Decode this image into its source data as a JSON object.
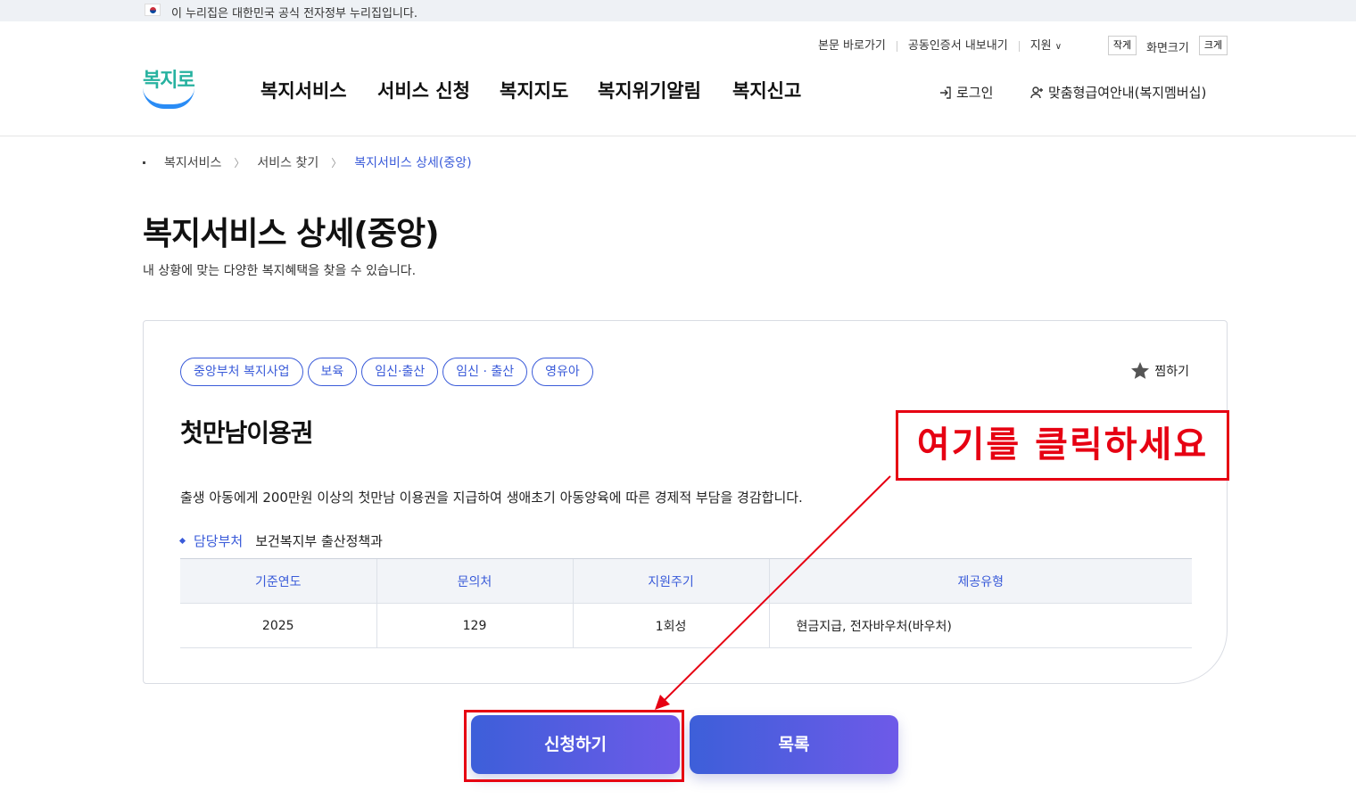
{
  "gov_banner": {
    "text": "이 누리집은 대한민국 공식 전자정부 누리집입니다."
  },
  "utility": {
    "skip_to_content": "본문 바로가기",
    "export_cert": "공동인증서 내보내기",
    "support": "지원",
    "font_small": "작게",
    "font_size_label": "화면크기",
    "font_large": "크게"
  },
  "logo": {
    "text": "복지로"
  },
  "nav": [
    "복지서비스",
    "서비스 신청",
    "복지지도",
    "복지위기알림",
    "복지신고"
  ],
  "header_links": {
    "login": "로그인",
    "membership": "맞춤형급여안내(복지멤버십)"
  },
  "breadcrumb": [
    "복지서비스",
    "서비스 찾기",
    "복지서비스 상세(중앙)"
  ],
  "page": {
    "title": "복지서비스 상세(중앙)",
    "description": "내 상황에 맞는 다양한 복지혜택을 찾을 수 있습니다."
  },
  "service": {
    "tags": [
      "중앙부처 복지사업",
      "보육",
      "임신·출산",
      "임신 · 출산",
      "영유아"
    ],
    "favorite_label": "찜하기",
    "name": "첫만남이용권",
    "description": "출생 아동에게 200만원 이상의 첫만남 이용권을 지급하여 생애초기 아동양육에 따른 경제적 부담을 경감합니다.",
    "department_label": "담당부처",
    "department": "보건복지부 출산정책과",
    "table": {
      "headers": [
        "기준연도",
        "문의처",
        "지원주기",
        "제공유형"
      ],
      "row": [
        "2025",
        "129",
        "1회성",
        "현금지급, 전자바우처(바우처)"
      ]
    }
  },
  "buttons": {
    "apply": "신청하기",
    "list": "목록"
  },
  "annotation": {
    "callout": "여기를 클릭하세요",
    "color": "#e60012"
  },
  "colors": {
    "accent": "#3a5bd9",
    "button_gradient_start": "#3d5fd9",
    "button_gradient_end": "#6e5ae8"
  },
  "icons": {
    "login": "login-icon",
    "membership": "user-plus-icon",
    "favorite": "star-icon",
    "support_dropdown": "chevron-down-icon",
    "flag": "korea-flag-icon"
  }
}
